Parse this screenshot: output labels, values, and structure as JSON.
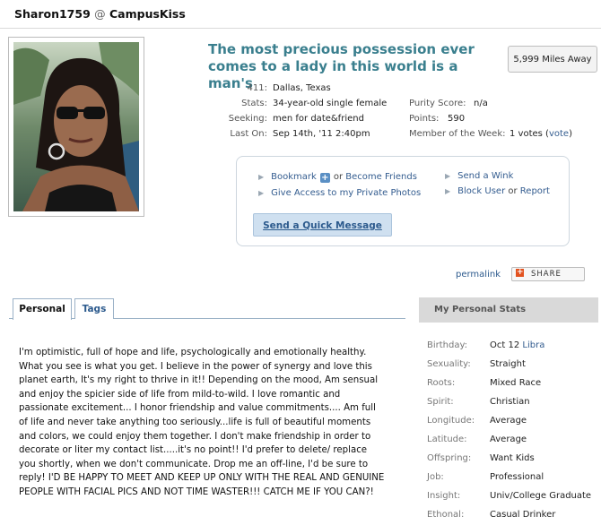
{
  "header": {
    "username": "Sharon1759",
    "at": "@",
    "site": "CampusKiss"
  },
  "profile": {
    "headline": "The most precious possession ever comes to a lady in this world is a man's",
    "distance": "5,999 Miles Away",
    "stats_left": [
      {
        "label": "411:",
        "value": "Dallas, Texas"
      },
      {
        "label": "Stats:",
        "value": "34-year-old single female"
      },
      {
        "label": "Seeking:",
        "value": "men for date&friend"
      },
      {
        "label": "Last On:",
        "value": "Sep 14th, '11 2:40pm"
      }
    ],
    "stats_right": [
      {
        "label": "Purity Score:",
        "value": "n/a"
      },
      {
        "label": "Points:",
        "value": "590"
      },
      {
        "label": "Member of the Week:",
        "value": "1 votes (",
        "link": "vote",
        "suffix": ")"
      }
    ]
  },
  "actions": {
    "bookmark": "Bookmark",
    "or": "or",
    "become_friends": "Become Friends",
    "give_access": "Give Access to my Private Photos",
    "send_wink": "Send a Wink",
    "block_user": "Block User",
    "report": "Report",
    "quick_message": "Send a Quick Message"
  },
  "share": {
    "permalink": "permalink",
    "share_label": "SHARE"
  },
  "tabs": [
    {
      "label": "Personal"
    },
    {
      "label": "Tags"
    }
  ],
  "about": "I'm optimistic, full of hope and life, psychologically and emotionally healthy. What you see is what you get. I believe in the power of synergy and love this planet earth, It's my right to thrive in it!! Depending on the mood, Am sensual and enjoy the spicier side of life from mild-to-wild. I love romantic and passionate excitement... I honor friendship and value commitments.... Am full of life and never take anything too seriously...life is full of beautiful moments and colors, we could enjoy them together. I don't make friendship in order to decorate or liter my contact list.....it's no point!! I'd prefer to delete/ replace you shortly, when we don't communicate. Drop me an off-line, I'd be sure to reply! I'D BE HAPPY TO MEET AND KEEP UP ONLY WITH THE REAL AND GENUINE PEOPLE WITH FACIAL PICS AND NOT TIME WASTER!!! CATCH ME IF YOU CAN?!",
  "personal_stats": {
    "title": "My Personal Stats",
    "rows": [
      {
        "label": "Birthday:",
        "value": "Oct 12",
        "link": "Libra"
      },
      {
        "label": "Sexuality:",
        "value": "Straight"
      },
      {
        "label": "Roots:",
        "value": "Mixed Race"
      },
      {
        "label": "Spirit:",
        "value": "Christian"
      },
      {
        "label": "Longitude:",
        "value": "Average"
      },
      {
        "label": "Latitude:",
        "value": "Average"
      },
      {
        "label": "Offspring:",
        "value": "Want Kids"
      },
      {
        "label": "Job:",
        "value": "Professional"
      },
      {
        "label": "Insight:",
        "value": "Univ/College Graduate"
      },
      {
        "label": "Ethonal:",
        "value": "Casual Drinker"
      }
    ]
  }
}
